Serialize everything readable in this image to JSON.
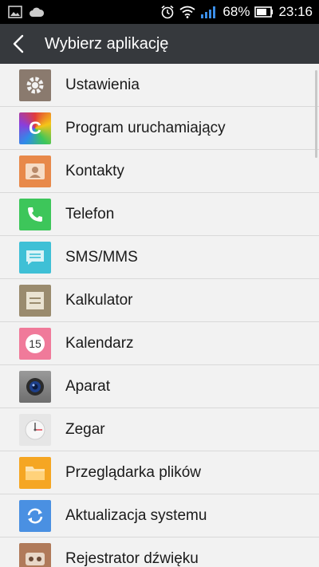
{
  "status_bar": {
    "battery_percent": "68%",
    "time": "23:16"
  },
  "header": {
    "title": "Wybierz aplikację"
  },
  "apps": [
    {
      "label": "Ustawienia",
      "icon": "settings-icon",
      "color": "#8a7a6e"
    },
    {
      "label": "Program uruchamiający",
      "icon": "launcher-icon",
      "color": "#7b4fd6"
    },
    {
      "label": "Kontakty",
      "icon": "contacts-icon",
      "color": "#e8894a"
    },
    {
      "label": "Telefon",
      "icon": "phone-icon",
      "color": "#3dc65a"
    },
    {
      "label": "SMS/MMS",
      "icon": "sms-icon",
      "color": "#3fc0d6"
    },
    {
      "label": "Kalkulator",
      "icon": "calculator-icon",
      "color": "#9a8b6e"
    },
    {
      "label": "Kalendarz",
      "icon": "calendar-icon",
      "color": "#f07a9a"
    },
    {
      "label": "Aparat",
      "icon": "camera-icon",
      "color": "#8a8a8a"
    },
    {
      "label": "Zegar",
      "icon": "clock-icon",
      "color": "#e0e0e0"
    },
    {
      "label": "Przeglądarka plików",
      "icon": "file-manager-icon",
      "color": "#f5a623"
    },
    {
      "label": "Aktualizacja systemu",
      "icon": "system-update-icon",
      "color": "#4a90e2"
    },
    {
      "label": "Rejestrator dźwięku",
      "icon": "sound-recorder-icon",
      "color": "#b07a5a"
    }
  ]
}
